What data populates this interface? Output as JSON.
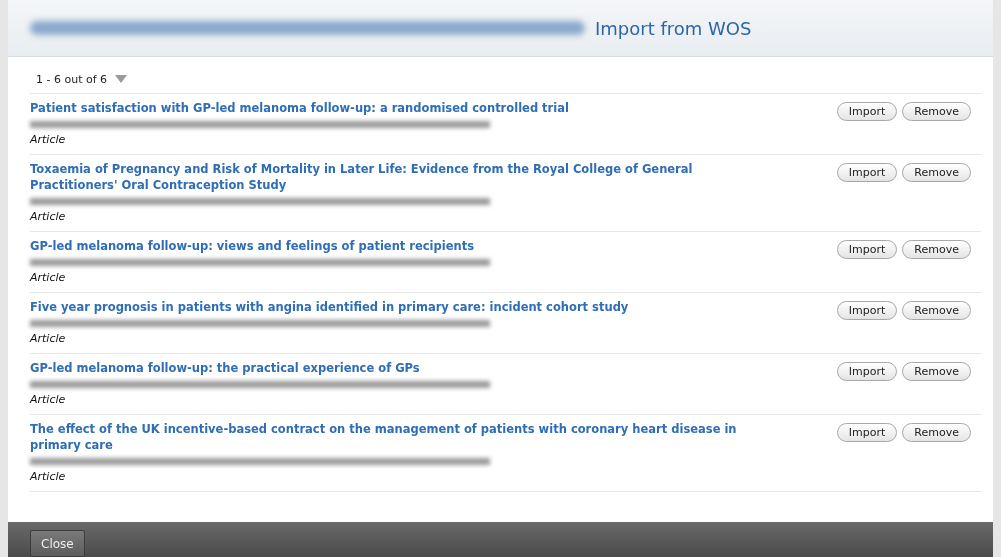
{
  "header": {
    "title": "Import from WOS"
  },
  "pager": {
    "label": "1 - 6 out of 6"
  },
  "records": [
    {
      "title": "Patient satisfaction with GP-led melanoma follow-up: a randomised controlled trial",
      "type": "Article",
      "buttons": [
        "Import",
        "Remove"
      ]
    },
    {
      "title": "Toxaemia of Pregnancy and Risk of Mortality in Later Life: Evidence from the Royal College of General Practitioners' Oral Contraception Study",
      "type": "Article",
      "buttons": [
        "Import",
        "Remove"
      ]
    },
    {
      "title": "GP-led melanoma follow-up: views and feelings of patient recipients",
      "type": "Article",
      "buttons": [
        "Import",
        "Remove"
      ]
    },
    {
      "title": "Five year prognosis in patients with angina identified in primary care: incident cohort study",
      "type": "Article",
      "buttons": [
        "Import",
        "Remove"
      ]
    },
    {
      "title": "GP-led melanoma follow-up: the practical experience of GPs",
      "type": "Article",
      "buttons": [
        "Import",
        "Remove"
      ]
    },
    {
      "title": "The effect of the UK incentive-based contract on the management of patients with coronary heart disease in primary care",
      "type": "Article",
      "buttons": [
        "Import",
        "Remove"
      ]
    }
  ],
  "footer": {
    "close": "Close"
  }
}
